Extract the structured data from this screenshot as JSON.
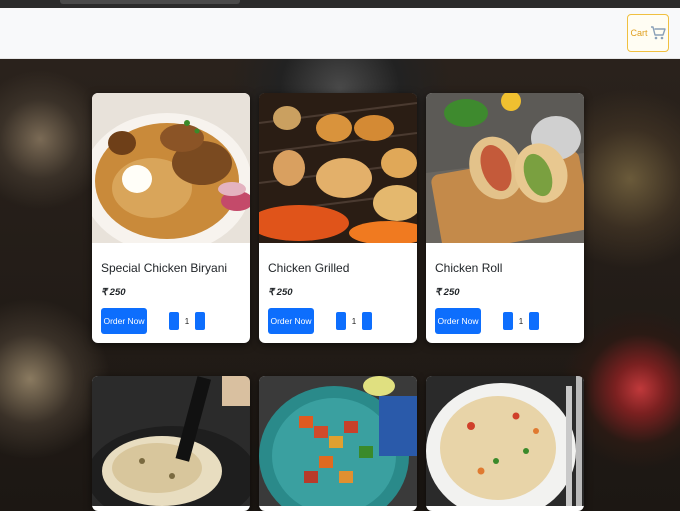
{
  "navbar": {
    "cart_label": "Cart",
    "cart_icon": "cart-icon"
  },
  "colors": {
    "accent": "#0d6efd",
    "cart_border": "#f0c040"
  },
  "products": [
    {
      "title": "Special Chicken Biryani",
      "price": "₹ 250",
      "order_label": "Order Now",
      "qty": "1"
    },
    {
      "title": "Chicken Grilled",
      "price": "₹ 250",
      "order_label": "Order Now",
      "qty": "1"
    },
    {
      "title": "Chicken Roll",
      "price": "₹ 250",
      "order_label": "Order Now",
      "qty": "1"
    }
  ],
  "bottom_products": [
    {
      "image": "naan-photo"
    },
    {
      "image": "kebab-skewers-photo"
    },
    {
      "image": "fried-rice-photo"
    }
  ]
}
